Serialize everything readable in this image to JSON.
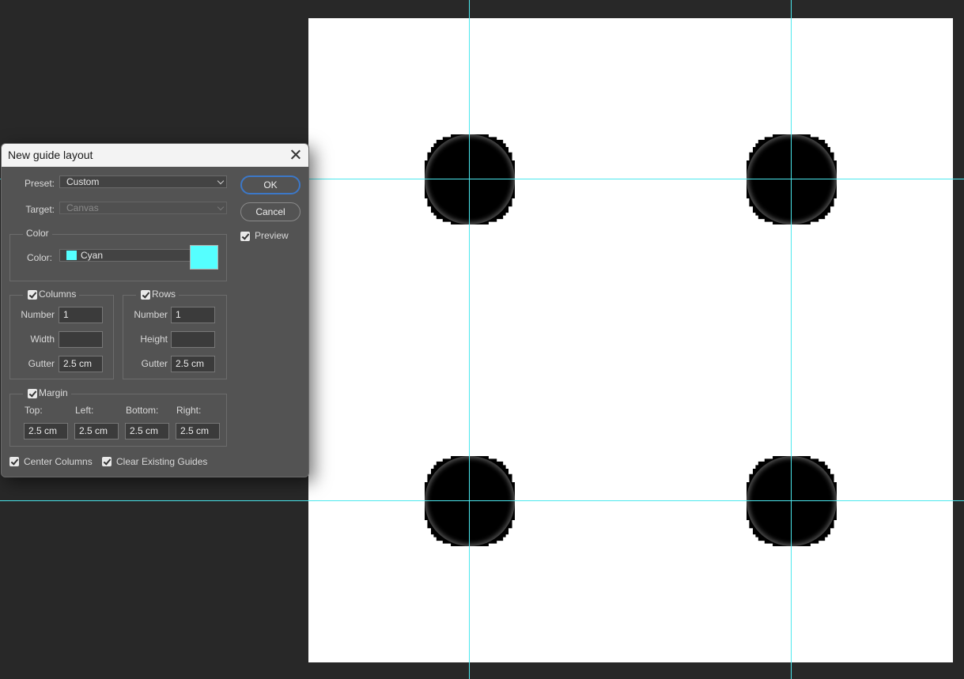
{
  "dialog": {
    "title": "New guide layout",
    "preset_label": "Preset:",
    "preset_value": "Custom",
    "target_label": "Target:",
    "target_value": "Canvas",
    "ok_label": "OK",
    "cancel_label": "Cancel",
    "preview_label": "Preview",
    "preview_checked": true,
    "color_group_title": "Color",
    "color_label": "Color:",
    "color_value": "Cyan",
    "color_hex": "#55ffff",
    "columns": {
      "title": "Columns",
      "checked": true,
      "number_label": "Number",
      "number_value": "1",
      "width_label": "Width",
      "width_value": "",
      "gutter_label": "Gutter",
      "gutter_value": "2.5 cm"
    },
    "rows": {
      "title": "Rows",
      "checked": true,
      "number_label": "Number",
      "number_value": "1",
      "height_label": "Height",
      "height_value": "",
      "gutter_label": "Gutter",
      "gutter_value": "2.5 cm"
    },
    "margin": {
      "title": "Margin",
      "checked": true,
      "top_label": "Top:",
      "left_label": "Left:",
      "bottom_label": "Bottom:",
      "right_label": "Right:",
      "top_value": "2.5 cm",
      "left_value": "2.5 cm",
      "bottom_value": "2.5 cm",
      "right_value": "2.5 cm"
    },
    "center_columns_label": "Center Columns",
    "center_columns_checked": true,
    "clear_guides_label": "Clear Existing Guides",
    "clear_guides_checked": true
  },
  "canvas": {
    "background": "#ffffff",
    "guide_color": "#4ce8ee",
    "dot_color": "#000000",
    "workspace_color": "#282828"
  }
}
